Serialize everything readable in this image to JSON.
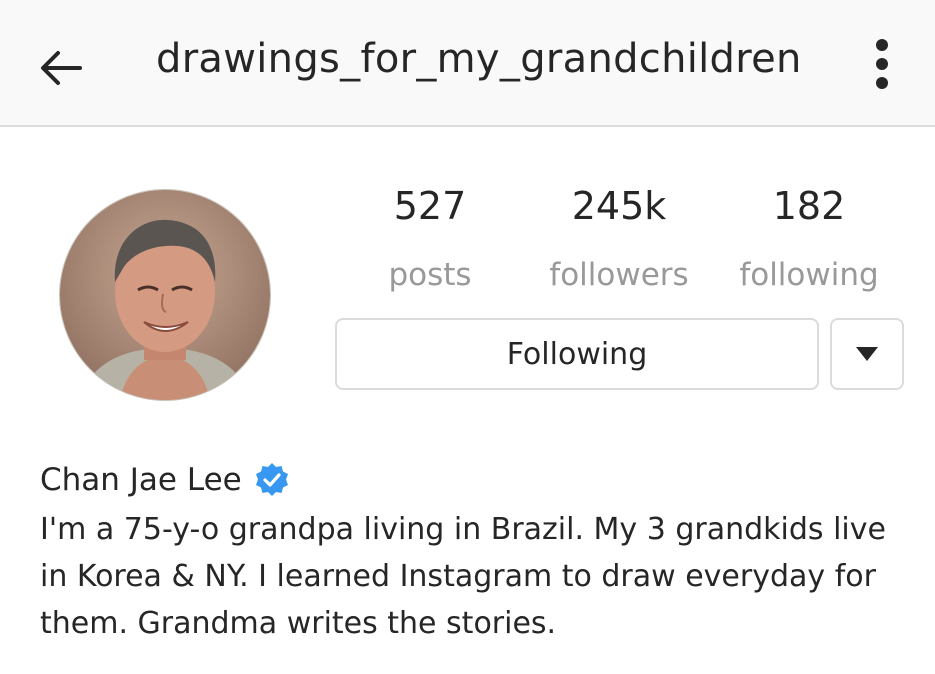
{
  "header": {
    "username": "drawings_for_my_grandchildren",
    "back_icon": "arrow-left-icon",
    "menu_icon": "vertical-ellipsis-icon"
  },
  "profile": {
    "avatar_icon": "profile-photo",
    "stats": [
      {
        "value": "527",
        "label": "posts"
      },
      {
        "value": "245k",
        "label": "followers"
      },
      {
        "value": "182",
        "label": "following"
      }
    ],
    "follow_button_label": "Following",
    "dropdown_icon": "caret-down-icon",
    "display_name": "Chan Jae Lee",
    "verified_icon": "verified-badge-icon",
    "bio": "I'm a 75-y-o grandpa living in Brazil. My 3 grandkids live in Korea & NY. I learned Instagram to draw everyday for them. Grandma writes the stories."
  },
  "colors": {
    "verified": "#3897f0",
    "muted_text": "#999999",
    "border": "#dbdbdb"
  }
}
